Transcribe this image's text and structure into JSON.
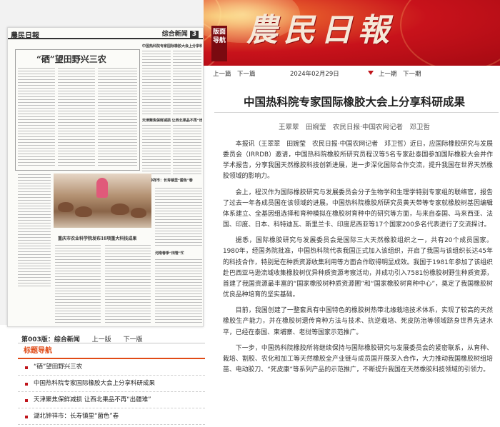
{
  "masthead": {
    "title": "農民日報",
    "nav_badge": "版面导航"
  },
  "thumbnail": {
    "logo": "農民日報",
    "section_name": "综合新闻",
    "section_num": "3",
    "headline_main": "“硒”望田野兴三农",
    "headline_small_1": "中国热科院专家国际橡胶大会上分享科研成果",
    "headline_small_2": "天津聚焦保鲜减损 让西北果品不再“出疆难”",
    "headline_small_3": "湖北钟祥市：长寿镇里“菌色”春",
    "headline_small_4": "重庆市农业科学院发布18项重大科技成果",
    "headline_small_5": "河南春季“田管”忙"
  },
  "issue_nav": {
    "edition_label": "第003版：综合新闻",
    "prev_label": "上一版",
    "next_label": "下一版"
  },
  "toc": {
    "title": "标题导航",
    "items": [
      "“硒”望田野兴三农",
      "中国热科院专家国际橡胶大会上分享科研成果",
      "天津聚焦保鲜减损 让西北果品不再“出疆难”",
      "湖北钟祥市：长寿镇里“菌色”春"
    ]
  },
  "date_nav": {
    "prev_page": "上一篇",
    "next_page": "下一篇",
    "date": "2024年02月29日",
    "prev_issue": "上一期",
    "next_issue": "下一期"
  },
  "article": {
    "headline": "中国热科院专家国际橡胶大会上分享科研成果",
    "byline": "王翠翠　田婉莹　农民日报·中国农网记者　邓卫哲",
    "paragraphs": [
      "本报讯（王翠翠　田婉莹　农民日报·中国农网记者　邓卫哲）近日，应国际橡胶研究与发展委员会（IRRDB）邀请，中国热科院橡胶所研究员程汉等5名专家赴泰国参加国际橡胶大会并作学术报告，分享我国天然橡胶科技创新进展，进一步深化国际合作交流，提升我国在世界天然橡胶领域的影响力。",
      "会上，程汉作为国际橡胶研究与发展委员会分子生物学和生理学特别专家组的联络官，报告了过去一年各成员国在该领域的进展。中国热科院橡胶所研究员黄天带等专家就橡胶树基因编辑体系建立、全基因组选择和育种模拟在橡胶树育种中的研究等方面，与来自泰国、马来西亚、法国、印度、日本、科特迪瓦、斯里兰卡、印度尼西亚等17个国家200多名代表进行了交流探讨。",
      "据悉，国际橡胶研究与发展委员会是国际三大天然橡胶组织之一，共有20个成员国家。1980年，经国务院批准，中国热科院代表我国正式加入该组织，开启了我国与该组织长达45年的科技合作，特别是在种质资源收集利用等方面合作取得明显成效。我国于1981年参加了该组织赴巴西亚马逊流域收集橡胶树优异种质资源考察活动，并成功引入7581份橡胶树野生种质资源，首建了我国资源最丰富的“国家橡胶树种质资源圃”和“国家橡胶树育种中心”，奠定了我国橡胶树优良品种培育的坚实基础。",
      "目前，我国创建了一整套具有中国特色的橡胶树热带北缘栽培技术体系，实现了较高的天然橡胶生产能力，并在橡胶树遗传育种方法与技术、抗逆栽培、死皮防治等领域跻身世界先进水平，已经在泰国、柬埔寨、老挝等国家示范推广。",
      "下一步，中国热科院橡胶所将继续保持与国际橡胶研究与发展委员会的紧密联系，从育种、栽培、割胶、农化和加工等天然橡胶全产业链与成员国开展深入合作，大力推动我国橡胶树组培苗、电动胶刀、“死皮康”等系列产品的示范推广，不断提升我国在天然橡胶科技领域的引领力。"
    ]
  },
  "colors": {
    "banner_red": "#c8121b",
    "accent_orange": "#e04a16",
    "badge_dark_red": "#7a0a10"
  }
}
